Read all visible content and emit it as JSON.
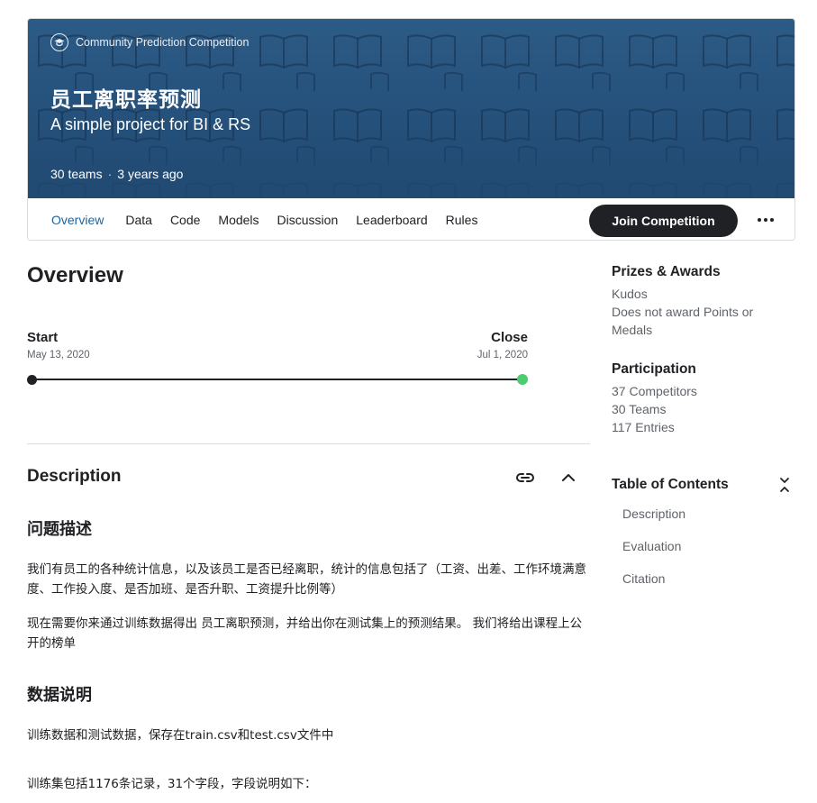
{
  "header": {
    "badge_label": "Community Prediction Competition",
    "title": "员工离职率预测",
    "subtitle": "A simple project for BI & RS",
    "teams": "30 teams",
    "separator": "·",
    "age": "3 years ago",
    "hero_color": "#24507a"
  },
  "tabs": [
    {
      "label": "Overview",
      "active": true
    },
    {
      "label": "Data"
    },
    {
      "label": "Code"
    },
    {
      "label": "Models"
    },
    {
      "label": "Discussion"
    },
    {
      "label": "Leaderboard"
    },
    {
      "label": "Rules"
    }
  ],
  "actions": {
    "join_label": "Join Competition",
    "more_icon": "more-horizontal-icon"
  },
  "overview": {
    "title": "Overview",
    "timeline": {
      "start_label": "Start",
      "start_date": "May 13, 2020",
      "close_label": "Close",
      "close_date": "Jul 1, 2020",
      "close_color": "#4ccb6f"
    }
  },
  "description": {
    "title": "Description",
    "link_icon": "link-icon",
    "collapse_icon": "chevron-up-icon",
    "section1_heading": "问题描述",
    "section1_p1": "我们有员工的各种统计信息，以及该员工是否已经离职，统计的信息包括了（工资、出差、工作环境满意度、工作投入度、是否加班、是否升职、工资提升比例等）",
    "section1_p2": "现在需要你来通过训练数据得出 员工离职预测，并给出你在测试集上的预测结果。 我们将给出课程上公开的榜单",
    "section2_heading": "数据说明",
    "section2_p1": "训练数据和测试数据，保存在train.csv和test.csv文件中",
    "section2_p2": "训练集包括1176条记录，31个字段，字段说明如下："
  },
  "sidebar": {
    "prizes_title": "Prizes & Awards",
    "prizes_line1": "Kudos",
    "prizes_line2": "Does not award Points or Medals",
    "participation_title": "Participation",
    "competitors": "37 Competitors",
    "teams": "30 Teams",
    "entries": "117 Entries",
    "toc_title": "Table of Contents",
    "toc_toggle_icon": "collapse-icon",
    "toc_items": [
      "Description",
      "Evaluation",
      "Citation"
    ]
  }
}
